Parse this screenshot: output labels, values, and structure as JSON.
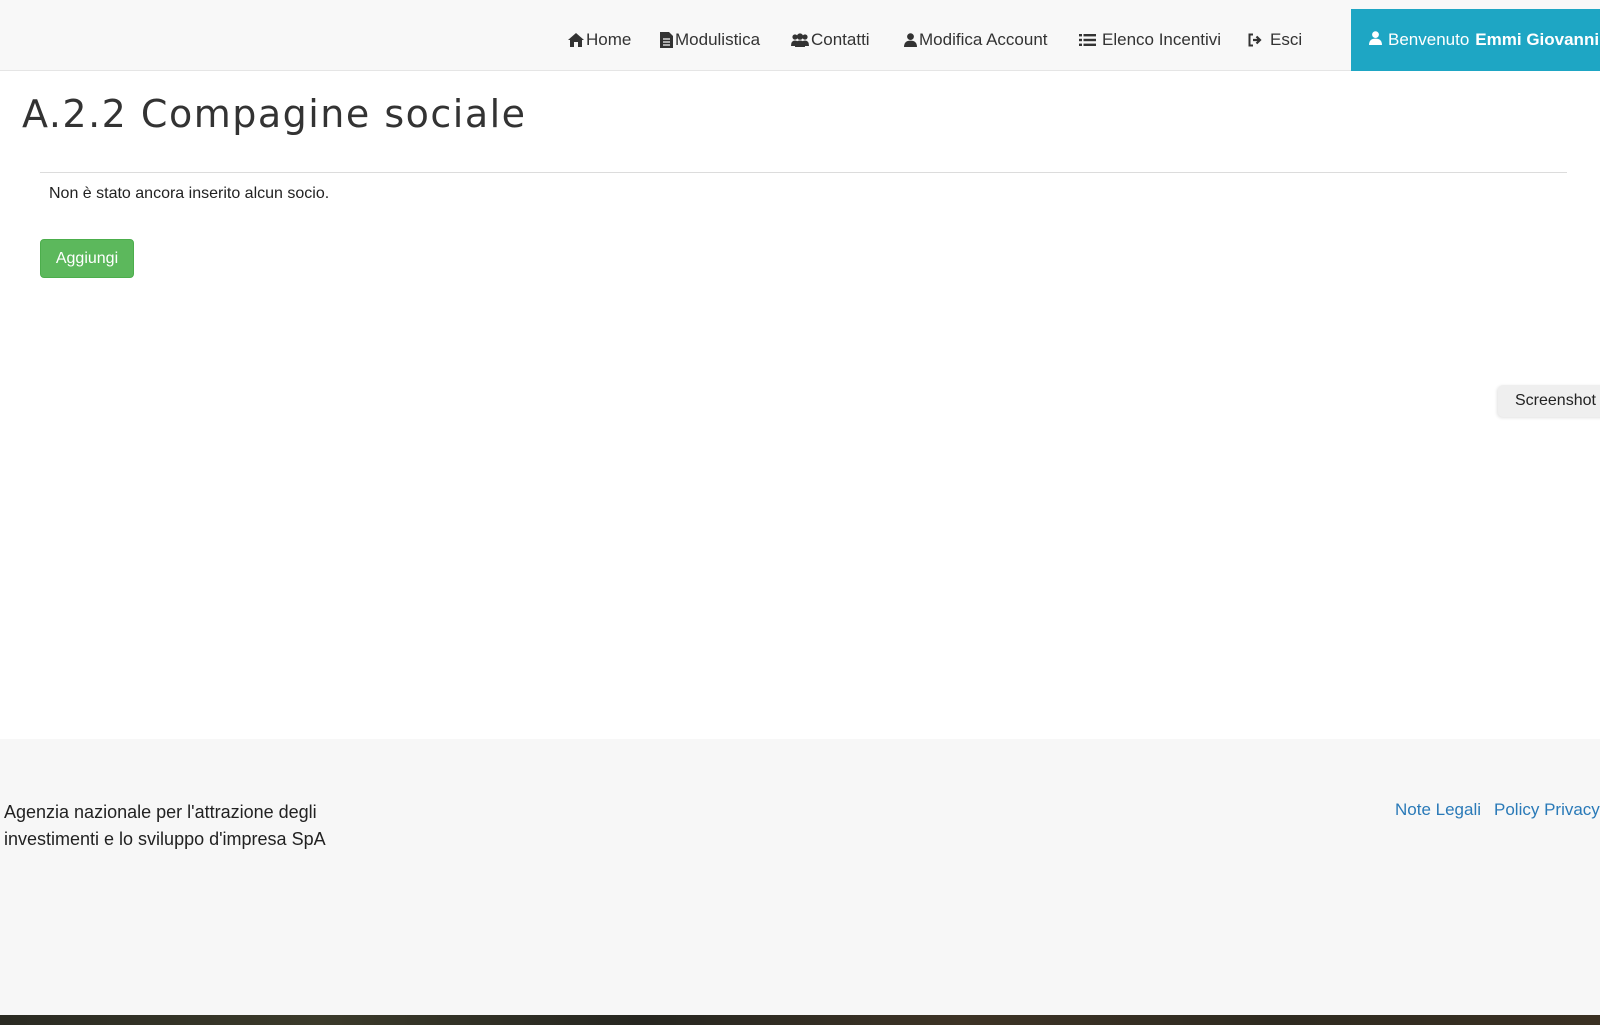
{
  "nav": {
    "items": [
      {
        "label": "Home",
        "icon": "home-icon"
      },
      {
        "label": "Modulistica",
        "icon": "document-icon"
      },
      {
        "label": "Contatti",
        "icon": "users-icon"
      },
      {
        "label": "Modifica Account",
        "icon": "user-icon"
      },
      {
        "label": "Elenco Incentivi",
        "icon": "list-icon"
      },
      {
        "label": "Esci",
        "icon": "sign-out-icon"
      }
    ],
    "welcome_prefix": "Benvenuto",
    "user_name": "Emmi Giovanni",
    "welcome_icon": "user-icon",
    "welcome_color": "#1ea6c4"
  },
  "main": {
    "title": "A.2.2 Compagine sociale",
    "empty_message": "Non è stato ancora inserito alcun socio.",
    "add_button_label": "Aggiungi",
    "add_button_color": "#5cb85c"
  },
  "side_tab": {
    "label": "Screenshot"
  },
  "footer": {
    "agency_line1": "Agenzia nazionale per l'attrazione degli",
    "agency_line2": "investimenti e lo sviluppo d'impresa SpA",
    "links": [
      "Note Legali",
      "Policy Privacy"
    ],
    "link_color": "#2a7ab8"
  }
}
